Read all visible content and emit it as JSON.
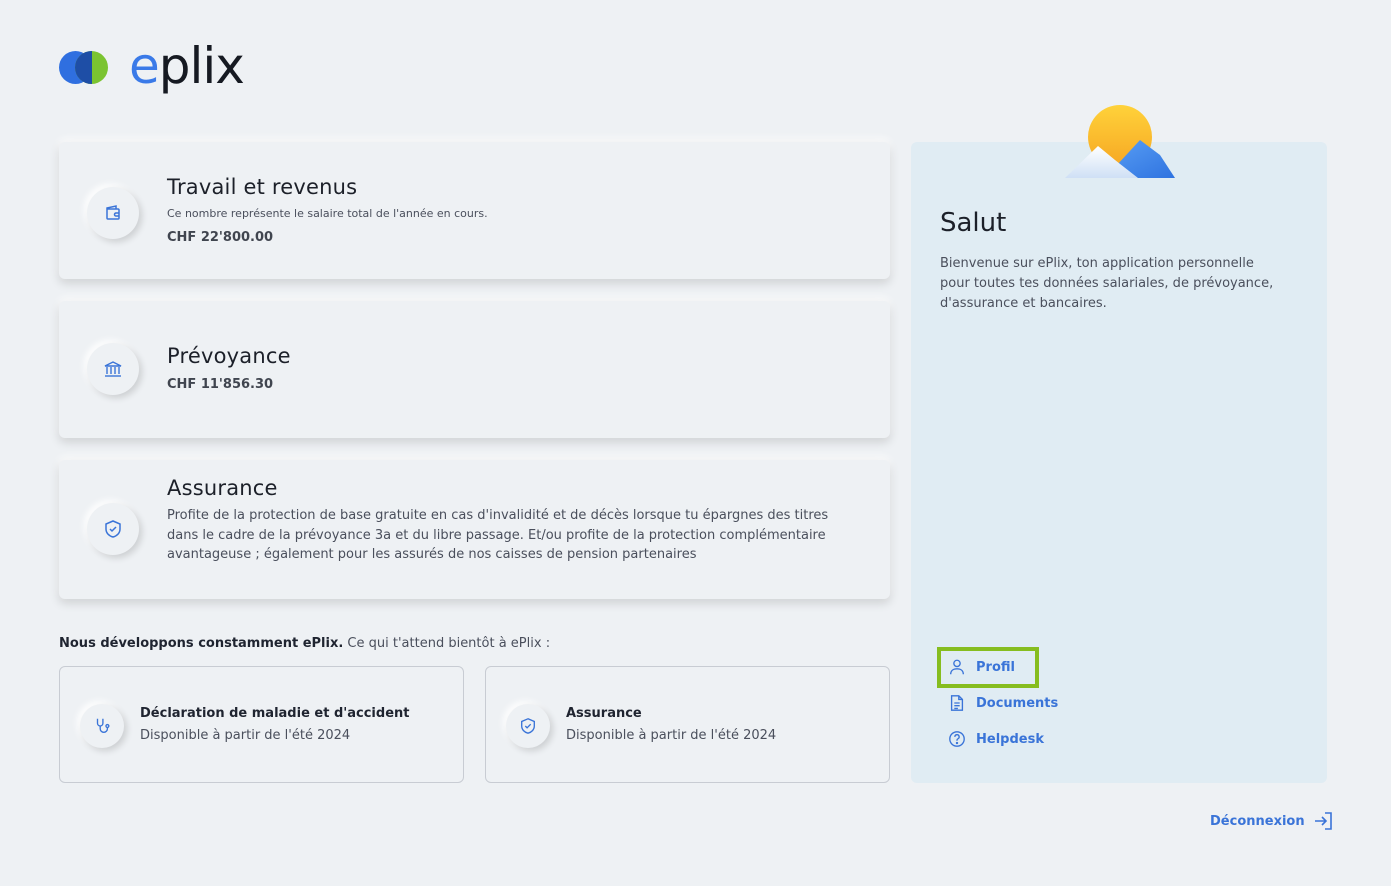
{
  "brand": {
    "name_prefix": "e",
    "name_rest": "plix"
  },
  "cards": [
    {
      "title": "Travail et revenus",
      "subtitle": "Ce nombre représente le salaire total de l'année en cours.",
      "amount": "CHF 22'800.00",
      "icon": "wallet-icon"
    },
    {
      "title": "Prévoyance",
      "amount": "CHF 11'856.30",
      "icon": "bank-icon"
    },
    {
      "title": "Assurance",
      "description": "Profite de la protection de base gratuite en cas d'invalidité et de décès lorsque tu épargnes des titres dans le cadre de la prévoyance 3a et du libre passage. Et/ou profite de la protection complémentaire avantageuse ; également pour les assurés de nos caisses de pension partenaires",
      "icon": "shield-icon"
    }
  ],
  "upcoming": {
    "intro_bold": "Nous développons constamment ePlix.",
    "intro_rest": " Ce qui t'attend bientôt à ePlix :",
    "items": [
      {
        "title": "Déclaration de maladie et d'accident",
        "subtitle": "Disponible à partir de l'été 2024",
        "icon": "stethoscope-icon"
      },
      {
        "title": "Assurance",
        "subtitle": "Disponible à partir de l'été 2024",
        "icon": "shield-icon"
      }
    ]
  },
  "sidebar": {
    "title": "Salut",
    "text": "Bienvenue sur ePlix, ton application personnelle pour toutes tes données salariales, de prévoyance, d'assurance et bancaires.",
    "nav": [
      {
        "label": "Profil",
        "icon": "user-icon"
      },
      {
        "label": "Documents",
        "icon": "document-icon"
      },
      {
        "label": "Helpdesk",
        "icon": "help-icon"
      }
    ]
  },
  "logout": {
    "label": "Déconnexion",
    "icon": "logout-icon"
  },
  "colors": {
    "accent": "#3a74d8",
    "highlight": "#86bd1f",
    "background": "#eef1f4",
    "sidebar": "#e0ecf3"
  }
}
